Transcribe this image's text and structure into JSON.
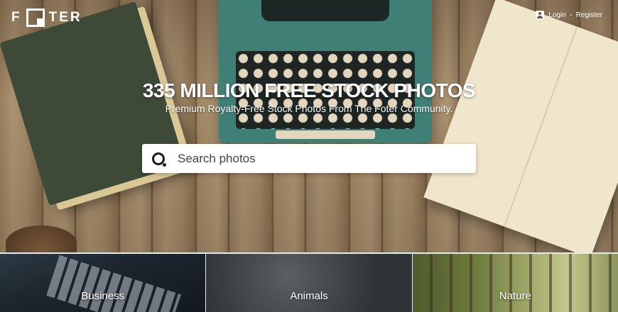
{
  "header": {
    "logo_letters": [
      "F",
      "T",
      "E",
      "R"
    ],
    "login_label": "Login",
    "register_label": "Register"
  },
  "hero": {
    "headline": "335 MILLION FREE STOCK PHOTOS",
    "subtitle": "Premium Royalty-Free Stock Photos From The Foter Community."
  },
  "search": {
    "placeholder": "Search photos",
    "icon": "search-icon"
  },
  "categories": [
    {
      "label": "Business"
    },
    {
      "label": "Animals"
    },
    {
      "label": "Nature"
    }
  ],
  "colors": {
    "text": "#ffffff",
    "search_bg": "#ffffff",
    "divider": "#e9e9e9"
  }
}
